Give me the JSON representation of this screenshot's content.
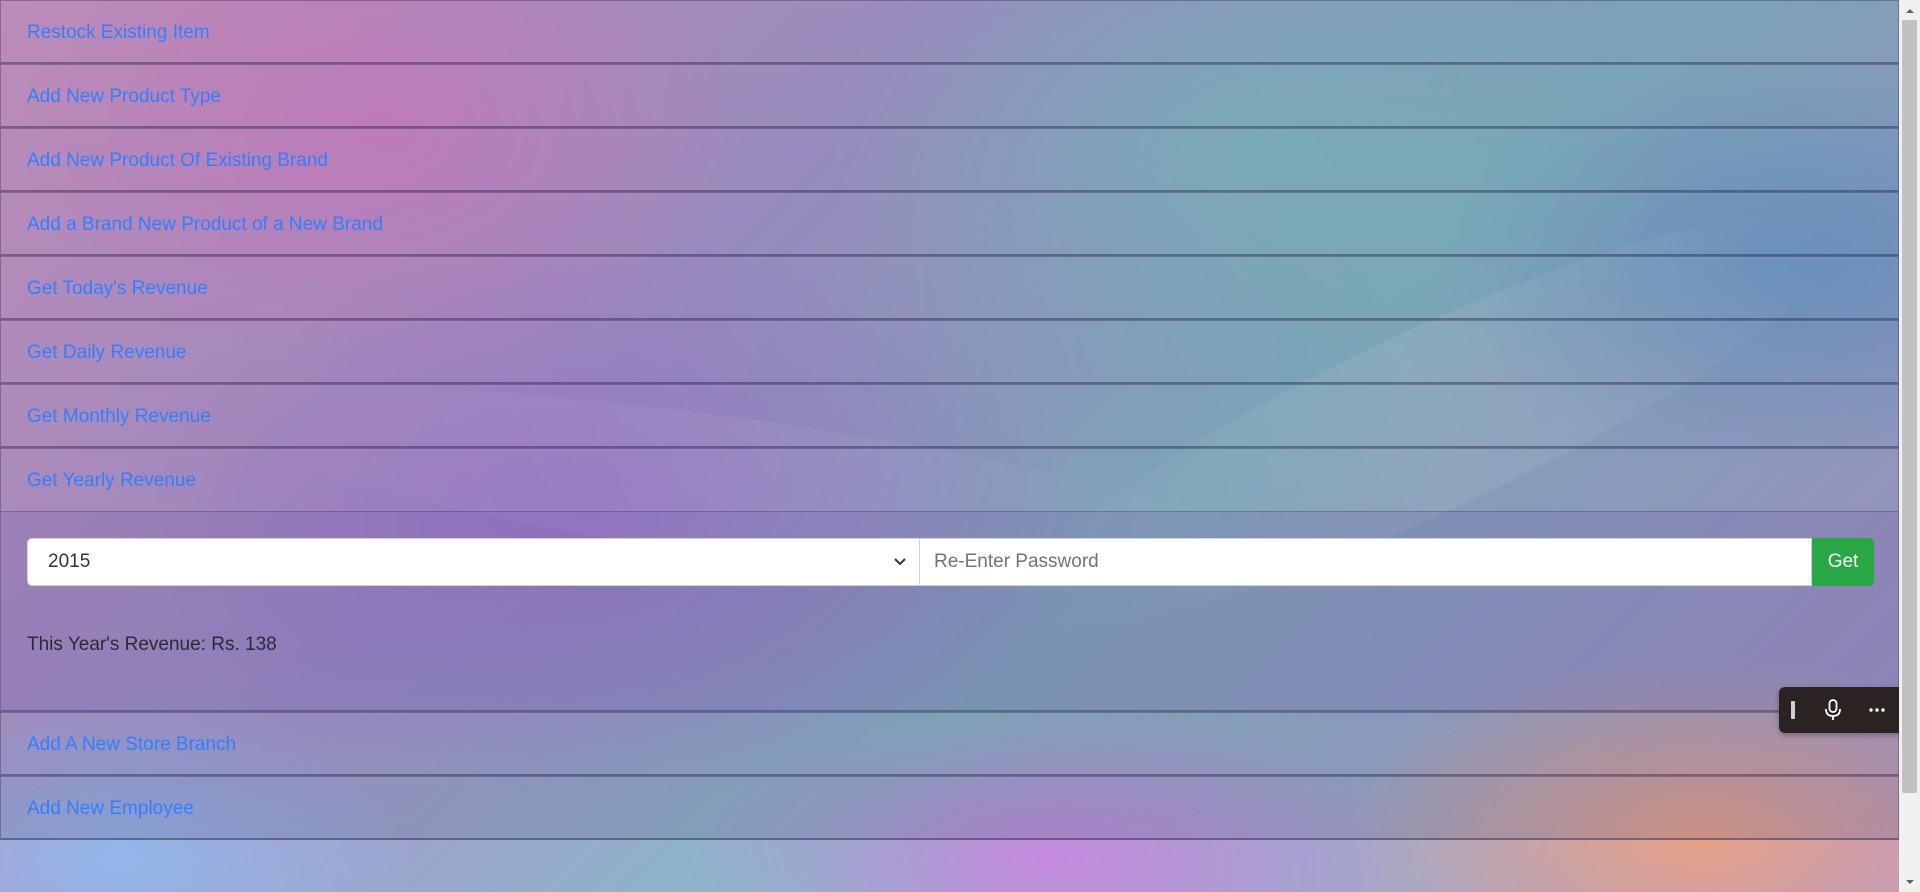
{
  "menu": {
    "items_before": [
      {
        "label": "Restock Existing Item"
      },
      {
        "label": "Add New Product Type"
      },
      {
        "label": "Add New Product Of Existing Brand"
      },
      {
        "label": "Add a Brand New Product of a New Brand"
      },
      {
        "label": "Get Today's Revenue"
      },
      {
        "label": "Get Daily Revenue"
      },
      {
        "label": "Get Monthly Revenue"
      },
      {
        "label": "Get Yearly Revenue"
      }
    ],
    "yearly_panel": {
      "year_select_value": "2015",
      "password_placeholder": "Re-Enter Password",
      "get_button_label": "Get",
      "revenue_text": "This Year's Revenue: Rs. 138"
    },
    "items_after": [
      {
        "label": "Add A New Store Branch"
      },
      {
        "label": "Add New Employee"
      }
    ]
  },
  "voice_toolbar": {
    "icons": [
      "grip-handle-icon",
      "microphone-icon",
      "more-options-icon"
    ]
  },
  "colors": {
    "link": "#2f80ff",
    "get_button": "#28a745",
    "toolbar_bg": "#2b2222"
  }
}
